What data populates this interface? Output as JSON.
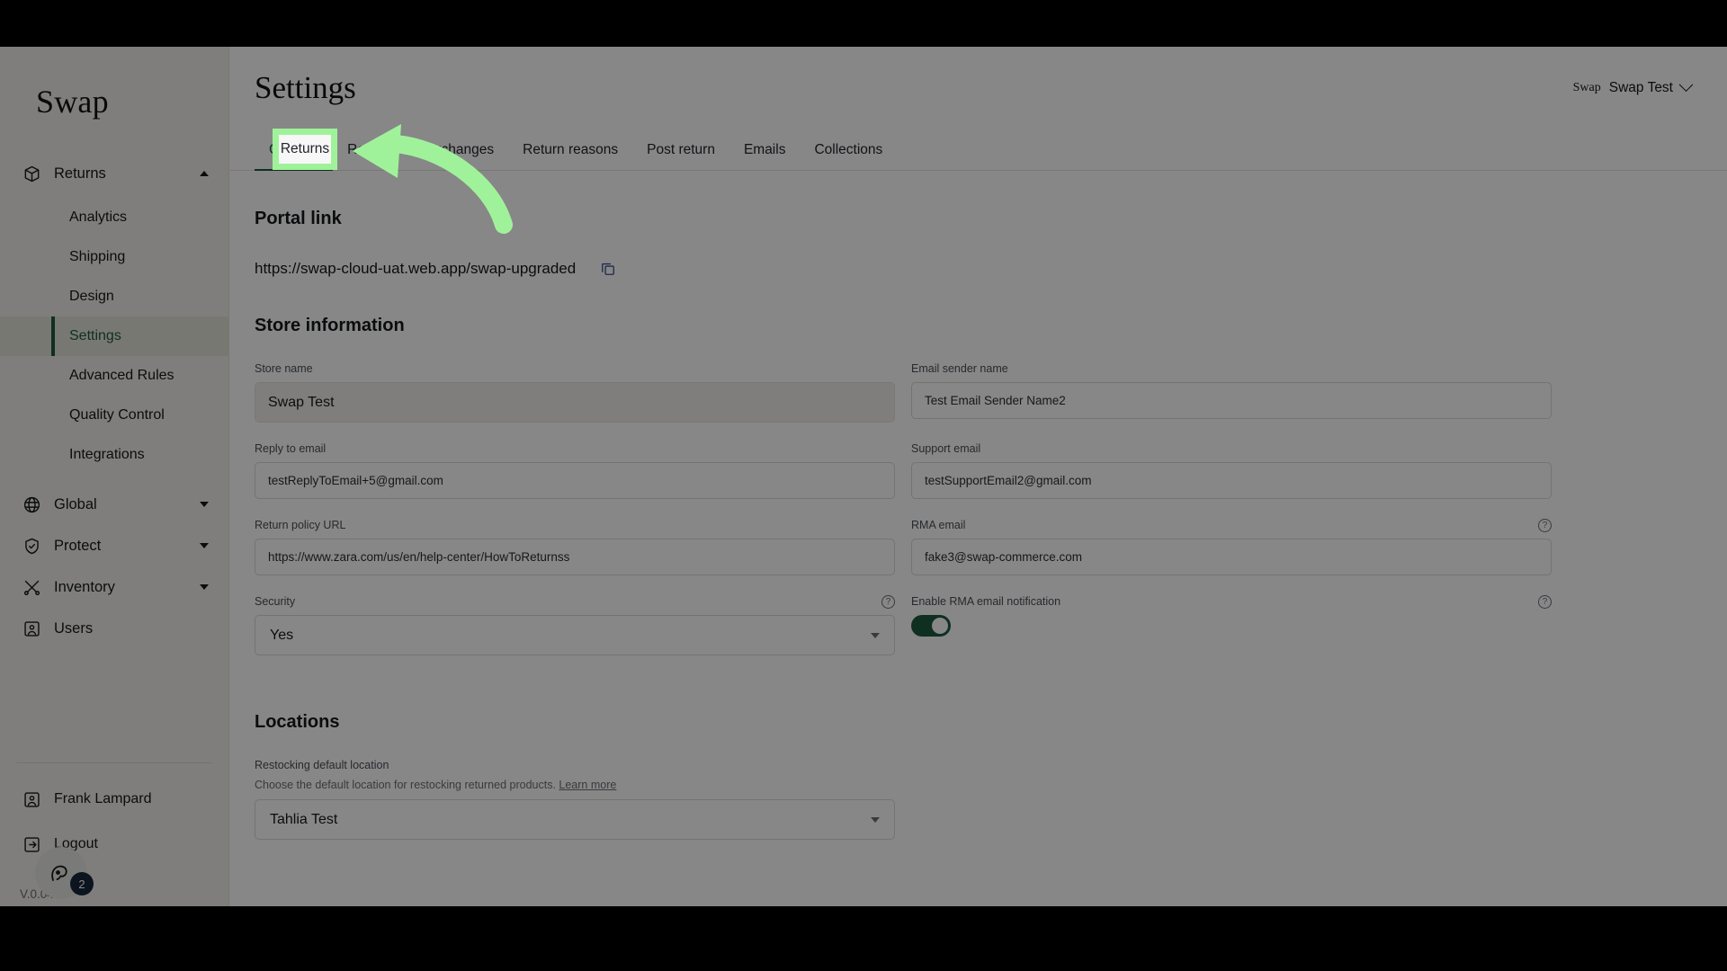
{
  "brand": "Swap",
  "sidebar": {
    "groups": [
      {
        "label": "Returns",
        "icon": "box-icon",
        "expanded": true,
        "items": [
          {
            "label": "Analytics",
            "active": false
          },
          {
            "label": "Shipping",
            "active": false
          },
          {
            "label": "Design",
            "active": false
          },
          {
            "label": "Settings",
            "active": true
          },
          {
            "label": "Advanced Rules",
            "active": false
          },
          {
            "label": "Quality Control",
            "active": false
          },
          {
            "label": "Integrations",
            "active": false
          }
        ]
      },
      {
        "label": "Global",
        "icon": "globe-icon",
        "expanded": false,
        "items": []
      },
      {
        "label": "Protect",
        "icon": "shield-check-icon",
        "expanded": false,
        "items": []
      },
      {
        "label": "Inventory",
        "icon": "scissors-icon",
        "expanded": false,
        "items": []
      },
      {
        "label": "Users",
        "icon": "user-icon",
        "expanded": null,
        "items": []
      }
    ],
    "footer": {
      "user": "Frank Lampard",
      "logout": "Logout",
      "version": "V.0.04"
    },
    "chat": {
      "badge": "2"
    }
  },
  "header": {
    "title": "Settings",
    "account_brand": "Swap",
    "account_name": "Swap Test"
  },
  "tabs": [
    {
      "label": "General",
      "active": true
    },
    {
      "label": "Returns",
      "active": false
    },
    {
      "label": "Exchanges",
      "active": false
    },
    {
      "label": "Return reasons",
      "active": false
    },
    {
      "label": "Post return",
      "active": false
    },
    {
      "label": "Emails",
      "active": false
    },
    {
      "label": "Collections",
      "active": false
    }
  ],
  "portal": {
    "heading": "Portal link",
    "url": "https://swap-cloud-uat.web.app/swap-upgraded",
    "copy_icon": "copy-icon"
  },
  "store_information": {
    "heading": "Store information",
    "fields": {
      "store_name": {
        "label": "Store name",
        "value": "Swap Test"
      },
      "email_sender_name": {
        "label": "Email sender name",
        "value": "Test Email Sender Name2"
      },
      "reply_to_email": {
        "label": "Reply to email",
        "value": "testReplyToEmail+5@gmail.com"
      },
      "support_email": {
        "label": "Support email",
        "value": "testSupportEmail2@gmail.com"
      },
      "return_policy_url": {
        "label": "Return policy URL",
        "value": "https://www.zara.com/us/en/help-center/HowToReturnss"
      },
      "rma_email": {
        "label": "RMA email",
        "value": "fake3@swap-commerce.com"
      },
      "security": {
        "label": "Security",
        "value": "Yes"
      },
      "enable_rma_notification": {
        "label": "Enable RMA email notification",
        "value": "on"
      }
    }
  },
  "locations": {
    "heading": "Locations",
    "restocking": {
      "label": "Restocking default location",
      "description": "Choose the default location for restocking returned products.",
      "link": "Learn more",
      "value": "Tahlia Test"
    }
  },
  "annotation": {
    "highlight_tab": "Returns",
    "color": "#a0f29a"
  },
  "colors": {
    "accent_green": "#1d5b3f",
    "sidebar_bg": "#f0efeb",
    "annotation_green": "#a0f29a",
    "badge_navy": "#17263c"
  }
}
